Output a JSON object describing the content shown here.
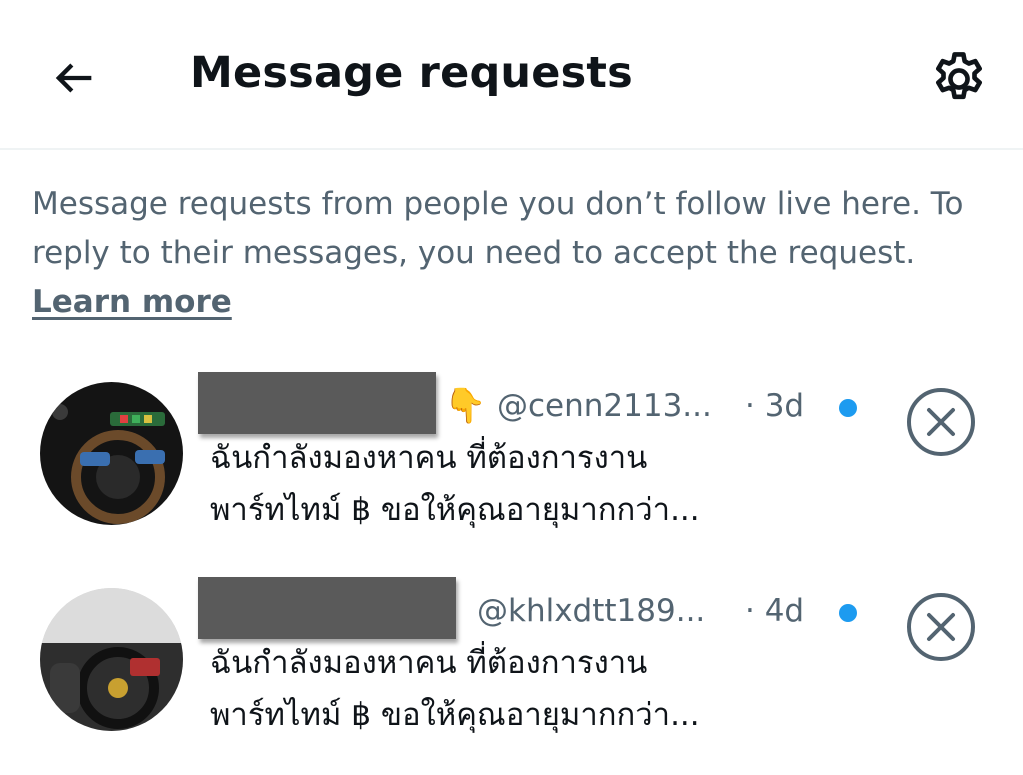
{
  "header": {
    "title": "Message requests",
    "back_icon": "arrow-left-icon",
    "settings_icon": "gear-icon"
  },
  "info": {
    "text": "Message requests from people you don’t follow live here. To reply to their messages, you need to accept the request.",
    "learn_more": "Learn more"
  },
  "requests": [
    {
      "emoji": "👇",
      "handle": "@cenn2113...",
      "time": "· 3d",
      "preview_line1": "ฉันกำลังมองหาคน ที่ต้องการงาน",
      "preview_line2": "พาร์ทไทม์ ฿ ขอให้คุณอายุมากกว่า...",
      "unread": true
    },
    {
      "emoji": "👇",
      "handle": "@khlxdtt189...",
      "time": "· 4d",
      "preview_line1": "ฉันกำลังมองหาคน ที่ต้องการงาน",
      "preview_line2": "พาร์ทไทม์ ฿ ขอให้คุณอายุมากกว่า...",
      "unread": true
    }
  ],
  "colors": {
    "accent": "#1d9bf0",
    "secondary_text": "#536471",
    "primary_text": "#0f1419"
  }
}
